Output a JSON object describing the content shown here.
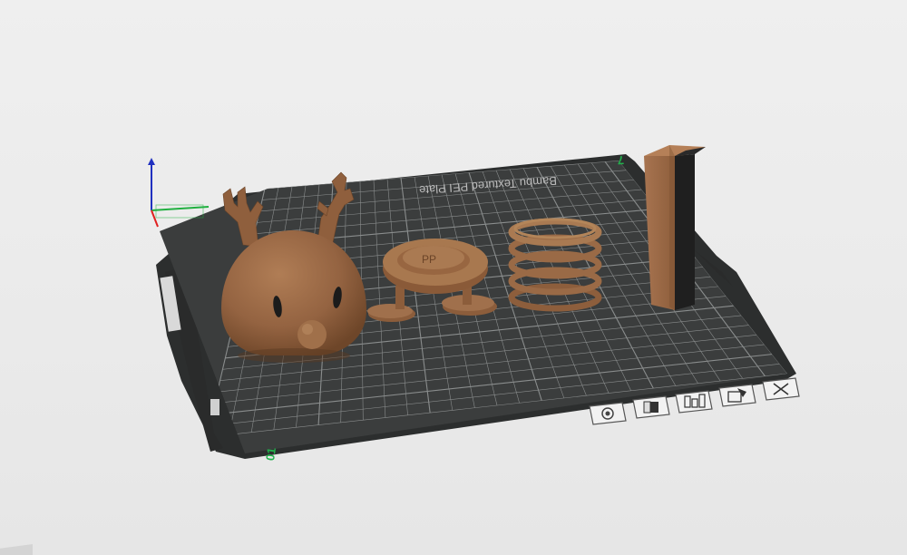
{
  "plate": {
    "label": "Bambu Textured PEI Plate",
    "axis_marker_left": "01",
    "axis_marker_right": "7"
  },
  "plate_toolbar": {
    "items": [
      {
        "name": "view-camera-icon",
        "label": "camera"
      },
      {
        "name": "orient-icon",
        "label": "orient"
      },
      {
        "name": "arrange-icon",
        "label": "arrange"
      },
      {
        "name": "plate-settings-icon",
        "label": "settings"
      },
      {
        "name": "delete-plate-icon",
        "label": "close"
      }
    ]
  },
  "models": [
    {
      "name": "reindeer-head"
    },
    {
      "name": "pp-stand"
    },
    {
      "name": "spring-coil"
    },
    {
      "name": "dual-color-block"
    }
  ],
  "colors": {
    "plate": "#3a3c3c",
    "plate_edge": "#2e3030",
    "grid": "#8a8d8d",
    "filament_brown": "#9c6b45",
    "filament_black": "#1f1f1f",
    "axis_x": "#e02020",
    "axis_y": "#20b040",
    "axis_z": "#2030c0",
    "marker_green": "#22b14c"
  }
}
